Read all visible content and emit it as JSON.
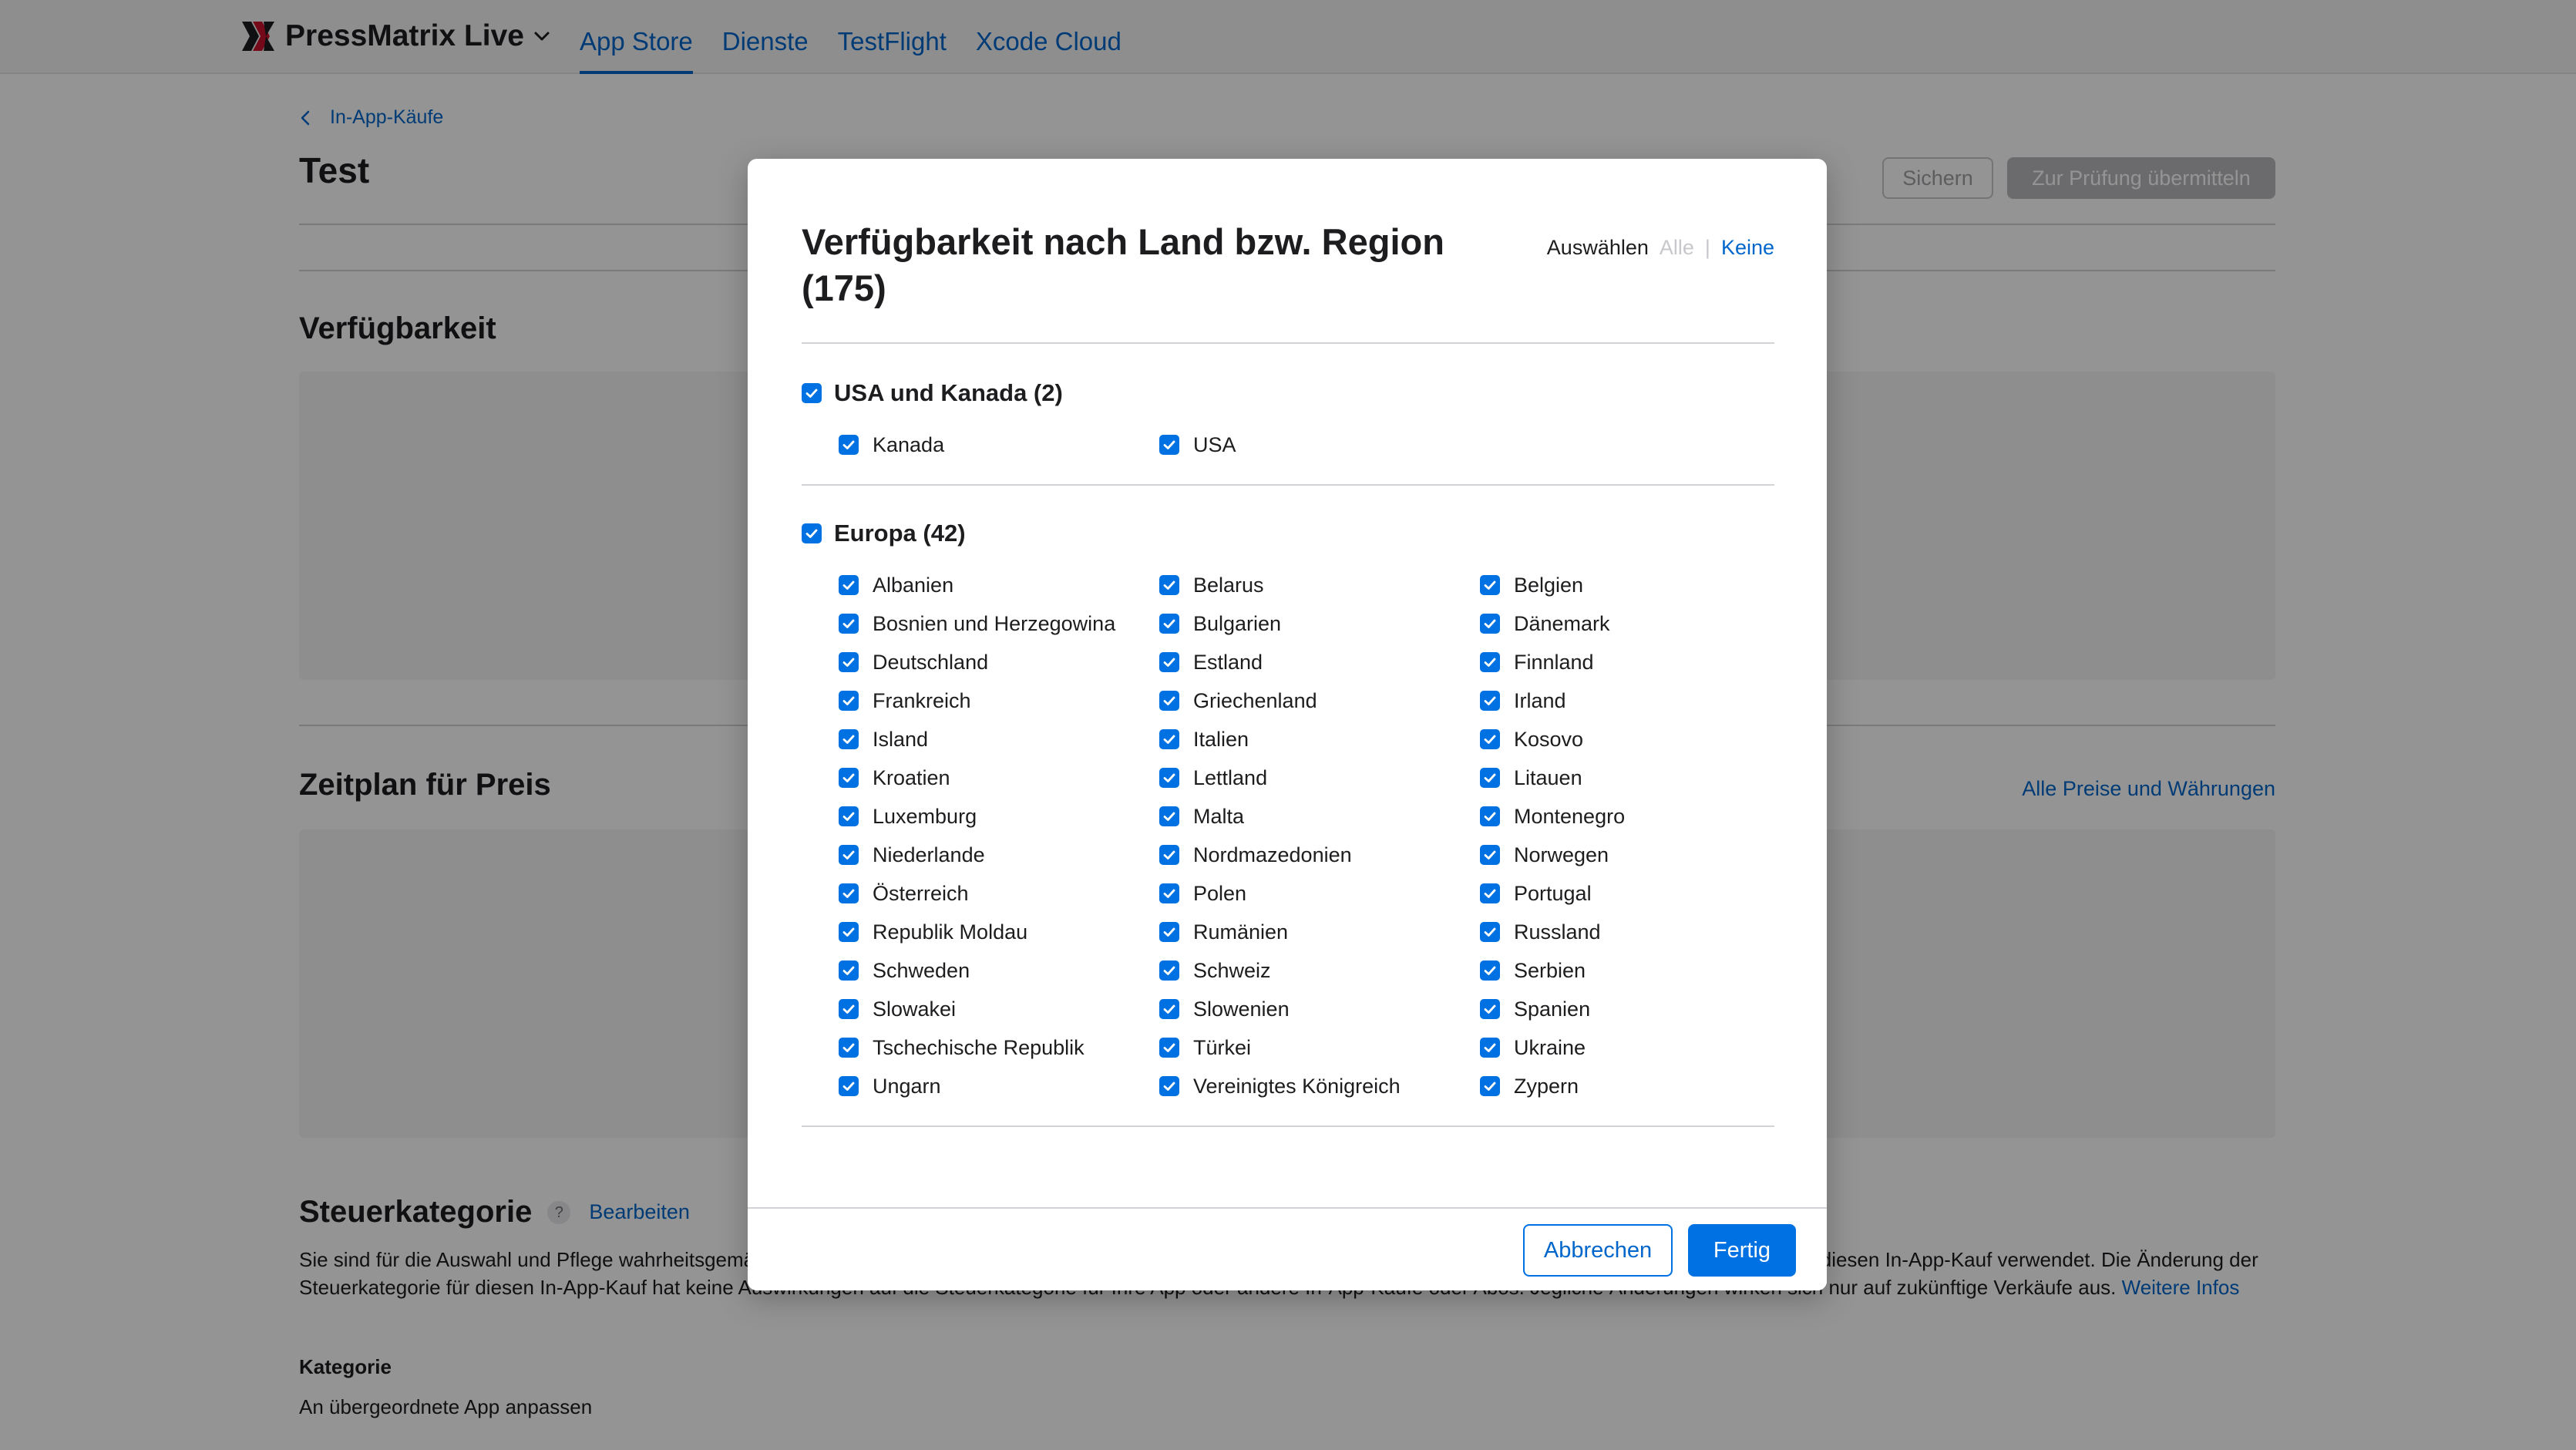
{
  "app": {
    "name": "PressMatrix Live",
    "nav": [
      "App Store",
      "Dienste",
      "TestFlight",
      "Xcode Cloud"
    ],
    "active_nav": "App Store"
  },
  "page": {
    "back_label": "In-App-Käufe",
    "title": "Test",
    "save_label": "Sichern",
    "submit_label": "Zur Prüfung übermitteln",
    "availability_title": "Verfügbarkeit",
    "price_title": "Zeitplan für Preis",
    "price_link": "Alle Preise und Währungen",
    "tax": {
      "title": "Steuerkategorie",
      "help": "?",
      "edit": "Bearbeiten",
      "text": "Sie sind für die Auswahl und Pflege wahrheitsgemäßer Steuerkategorien verantwortlich. Wenn Sie keine Steuerkategorie auswählen, wird die Steuerkategorie Ihrer App für diesen In-App-Kauf verwendet. Die Änderung der Steuerkategorie für diesen In-App-Kauf hat keine Auswirkungen auf die Steuerkategorie für Ihre App oder andere In-App-Käufe oder Abos. Jegliche Änderungen wirken sich nur auf zukünftige Verkäufe aus.",
      "more": "Weitere Infos",
      "category_label": "Kategorie",
      "category_value": "An übergeordnete App anpassen"
    }
  },
  "modal": {
    "title": "Verfügbarkeit nach Land bzw. Region (175)",
    "select_label": "Auswählen",
    "select_all": "Alle",
    "select_sep": "|",
    "select_none": "Keine",
    "groups": [
      {
        "label": "USA und Kanada (2)",
        "checked": true,
        "items": [
          "Kanada",
          "USA"
        ]
      },
      {
        "label": "Europa (42)",
        "checked": true,
        "items": [
          "Albanien",
          "Belarus",
          "Belgien",
          "Bosnien und Herzegowina",
          "Bulgarien",
          "Dänemark",
          "Deutschland",
          "Estland",
          "Finnland",
          "Frankreich",
          "Griechenland",
          "Irland",
          "Island",
          "Italien",
          "Kosovo",
          "Kroatien",
          "Lettland",
          "Litauen",
          "Luxemburg",
          "Malta",
          "Montenegro",
          "Niederlande",
          "Nordmazedonien",
          "Norwegen",
          "Österreich",
          "Polen",
          "Portugal",
          "Republik Moldau",
          "Rumänien",
          "Russland",
          "Schweden",
          "Schweiz",
          "Serbien",
          "Slowakei",
          "Slowenien",
          "Spanien",
          "Tschechische Republik",
          "Türkei",
          "Ukraine",
          "Ungarn",
          "Vereinigtes Königreich",
          "Zypern"
        ]
      }
    ],
    "cancel_label": "Abbrechen",
    "done_label": "Fertig"
  },
  "colors": {
    "accent": "#0071e3",
    "link": "#0066cc",
    "overlay": "rgba(0,0,0,0.42)"
  }
}
